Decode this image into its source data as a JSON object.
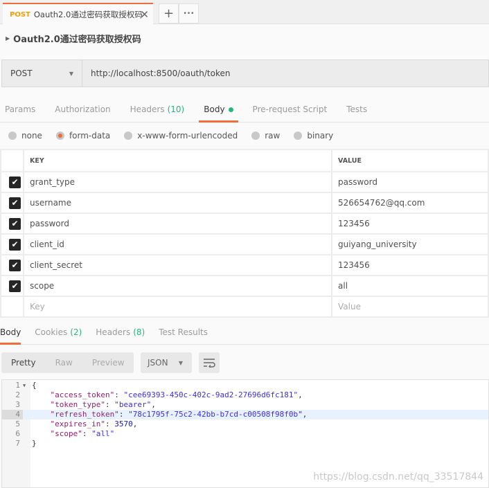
{
  "tab": {
    "method": "POST",
    "title": "Oauth2.0通过密码获取授权码",
    "close": "✕",
    "add": "+",
    "more": "•••"
  },
  "request": {
    "name": "Oauth2.0通过密码获取授权码",
    "method": "POST",
    "url": "http://localhost:8500/oauth/token"
  },
  "req_tabs": [
    {
      "label": "Params"
    },
    {
      "label": "Authorization"
    },
    {
      "label": "Headers",
      "count": "(10)"
    },
    {
      "label": "Body"
    },
    {
      "label": "Pre-request Script"
    },
    {
      "label": "Tests"
    }
  ],
  "body_types": [
    "none",
    "form-data",
    "x-www-form-urlencoded",
    "raw",
    "binary"
  ],
  "body_selected": "form-data",
  "table": {
    "headers": [
      "KEY",
      "VALUE"
    ],
    "rows": [
      {
        "key": "grant_type",
        "value": "password"
      },
      {
        "key": "username",
        "value": "526654762@qq.com"
      },
      {
        "key": "password",
        "value": "123456"
      },
      {
        "key": "client_id",
        "value": "guiyang_university"
      },
      {
        "key": "client_secret",
        "value": "123456"
      },
      {
        "key": "scope",
        "value": "all"
      }
    ],
    "placeholder_key": "Key",
    "placeholder_value": "Value"
  },
  "res_tabs": [
    {
      "label": "Body"
    },
    {
      "label": "Cookies",
      "count": "(2)"
    },
    {
      "label": "Headers",
      "count": "(8)"
    },
    {
      "label": "Test Results"
    }
  ],
  "view_modes": [
    "Pretty",
    "Raw",
    "Preview"
  ],
  "format": "JSON",
  "code_lines": [
    "1",
    "2",
    "3",
    "4",
    "5",
    "6",
    "7"
  ],
  "json": {
    "open": "{",
    "close": "}",
    "k1": "\"access_token\"",
    "v1": "\"cee69393-450c-402c-9ad2-27696d6fc181\"",
    "k2": "\"token_type\"",
    "v2": "\"bearer\"",
    "k3": "\"refresh_token\"",
    "v3": "\"78c1795f-75c2-42bb-b7cd-c00508f98f0b\"",
    "k4": "\"expires_in\"",
    "v4": "3570",
    "k5": "\"scope\"",
    "v5": "\"all\""
  },
  "watermark": "https://blog.csdn.net/qq_33517844",
  "colors": {
    "accent": "#f26b3a",
    "green": "#2bb57d",
    "method": "#f4a000"
  }
}
